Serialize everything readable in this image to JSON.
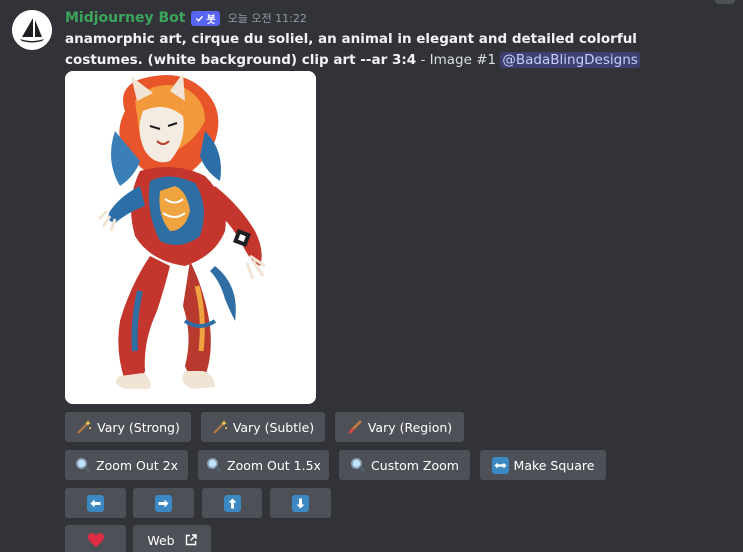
{
  "header": {
    "username": "Midjourney Bot",
    "bot_tag": "봇",
    "timestamp": "오늘 오전 11:22"
  },
  "message": {
    "prompt": "anamorphic art, cirque du soliel, an animal in elegant and detailed colorful costumes. (white background) clip art --ar 3:4",
    "suffix": " - Image #1 ",
    "mention": "@BadaBlingDesigns"
  },
  "buttons": {
    "vary_strong": "Vary (Strong)",
    "vary_subtle": "Vary (Subtle)",
    "vary_region": "Vary (Region)",
    "zoom_out_2x": "Zoom Out 2x",
    "zoom_out_1_5x": "Zoom Out 1.5x",
    "custom_zoom": "Custom Zoom",
    "make_square": "Make Square",
    "web": "Web"
  },
  "icons": {
    "sparkle": "magic-wand-icon",
    "brush": "paintbrush-icon",
    "magnifier": "magnifying-glass-icon",
    "expand": "left-right-arrow-icon",
    "left": "arrow-left-icon",
    "right": "arrow-right-icon",
    "up": "arrow-up-icon",
    "down": "arrow-down-icon",
    "heart": "heart-icon",
    "external": "external-link-icon"
  },
  "colors": {
    "background": "#313338",
    "button": "#4e5058",
    "username": "#3ba55c",
    "bot_tag": "#5865f2",
    "arrow_box": "#3b88c3",
    "heart": "#dd2e44"
  }
}
